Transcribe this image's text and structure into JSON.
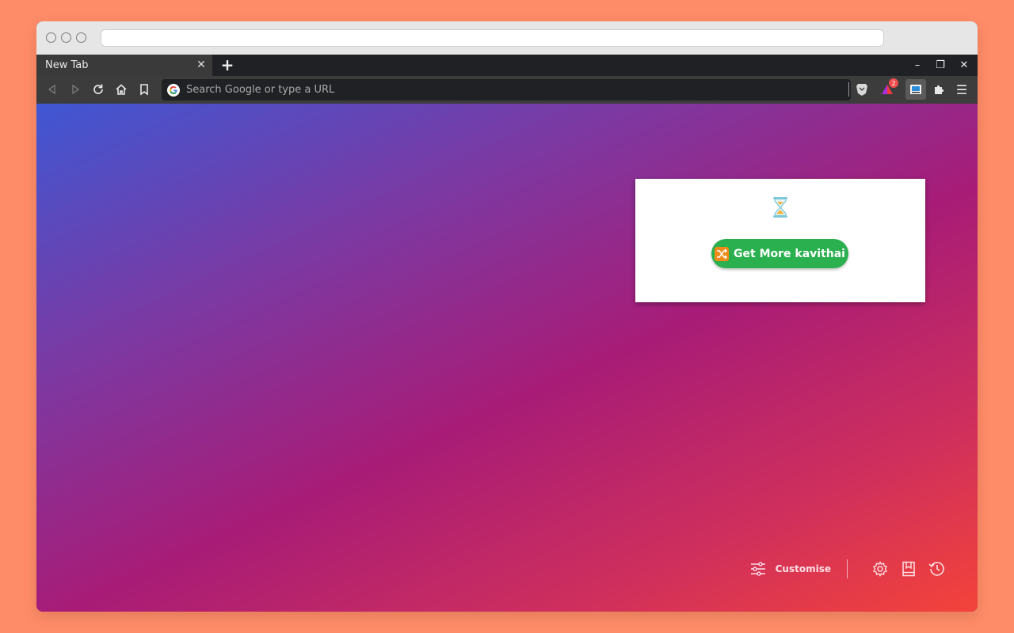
{
  "tab": {
    "title": "New Tab",
    "close_glyph": "✕",
    "new_tab_glyph": "+"
  },
  "window_controls": {
    "minimize": "–",
    "restore": "❐",
    "close": "✕"
  },
  "toolbar": {
    "back_icon": "back-arrow-icon",
    "forward_icon": "forward-arrow-icon",
    "reload_icon": "reload-icon",
    "home_icon": "home-icon",
    "bookmark_icon": "bookmark-icon",
    "omnibox_placeholder": "Search Google or type a URL",
    "brave_rewards_badge": "2",
    "menu_glyph": "☰"
  },
  "popup": {
    "status_icon": "hourglass-icon",
    "button_label": "Get More kavithai",
    "button_icon": "shuffle-icon"
  },
  "bottom_bar": {
    "customise_label": "Customise",
    "icons": [
      "sliders-icon",
      "settings-icon",
      "bookmarks-icon",
      "history-icon"
    ]
  },
  "colors": {
    "page_background": "#ff8c68",
    "button_green": "#2ab04e",
    "gradient_start": "#3f57d3",
    "gradient_end": "#f4433a"
  }
}
